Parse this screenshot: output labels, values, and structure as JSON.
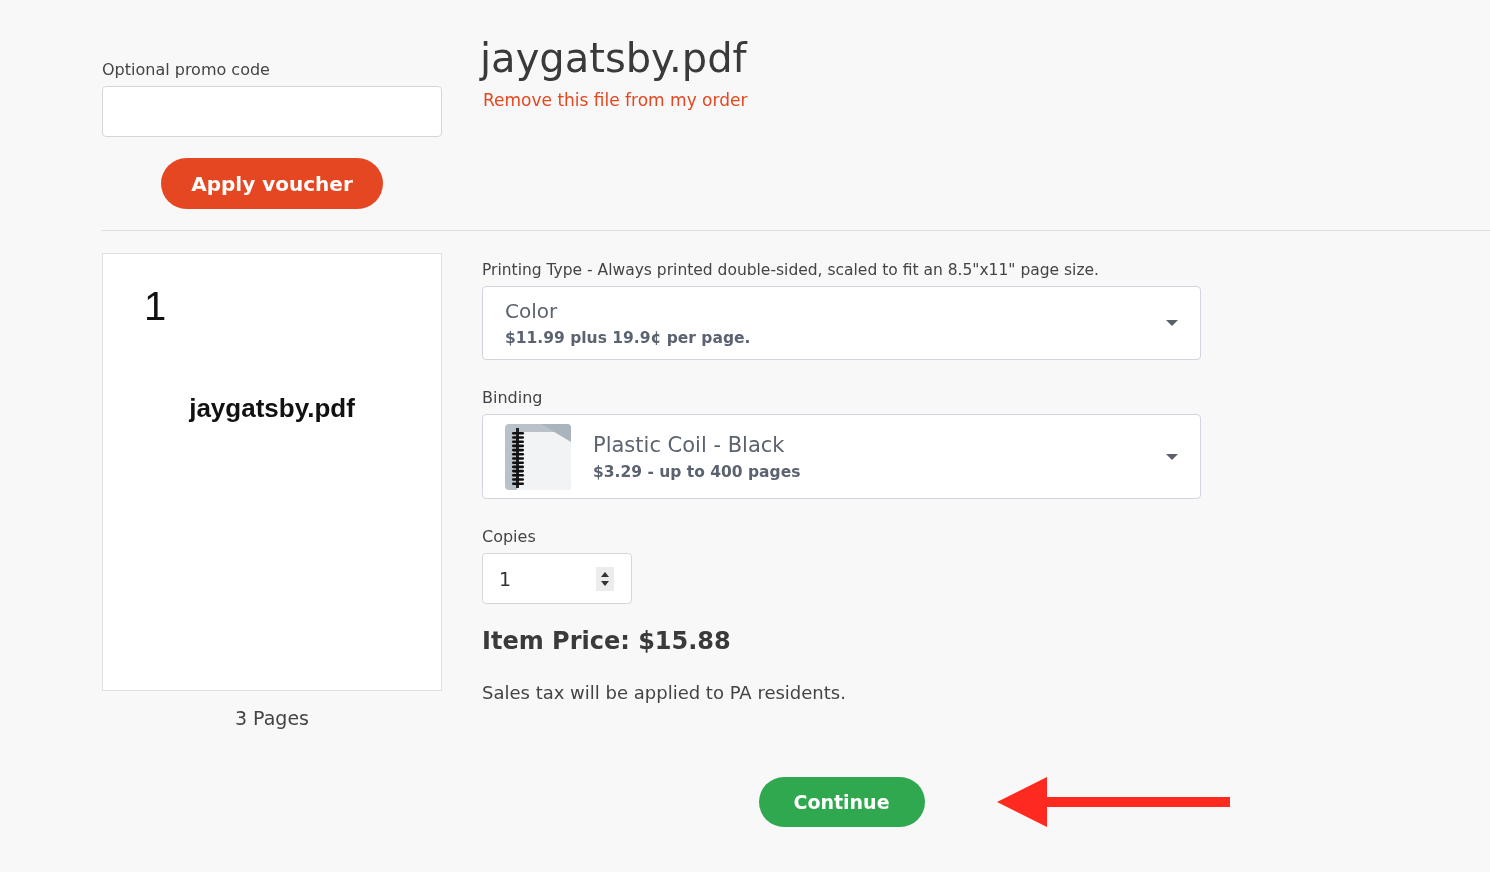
{
  "promo": {
    "label": "Optional promo code",
    "apply_button": "Apply voucher"
  },
  "file": {
    "title": "jaygatsby.pdf",
    "remove_link": "Remove this file from my order"
  },
  "preview": {
    "page_number": "1",
    "page_text": "jaygatsby.pdf",
    "page_count": "3 Pages"
  },
  "printing_type": {
    "label": "Printing Type - Always printed double-sided, scaled to fit an 8.5\"x11\" page size.",
    "value": "Color",
    "detail": "$11.99 plus 19.9¢ per page."
  },
  "binding": {
    "label": "Binding",
    "value": "Plastic Coil - Black",
    "detail": "$3.29 - up to 400 pages"
  },
  "copies": {
    "label": "Copies",
    "value": "1"
  },
  "item_price": "Item Price: $15.88",
  "tax_note": "Sales tax will be applied to PA residents.",
  "continue_button": "Continue"
}
